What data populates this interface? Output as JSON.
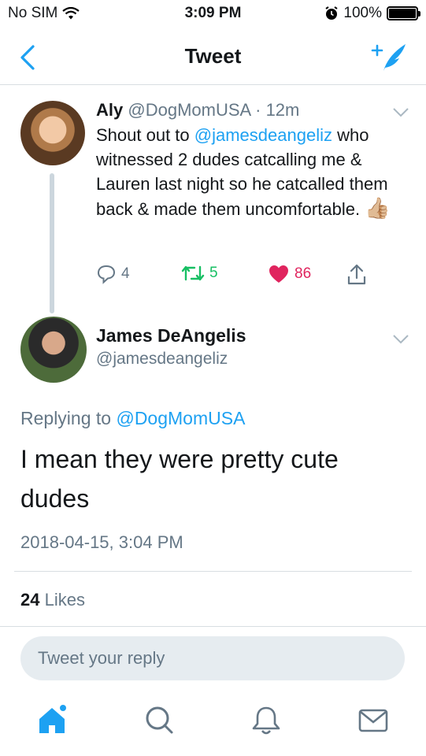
{
  "status_bar": {
    "carrier": "No SIM",
    "time": "3:09 PM",
    "battery": "100%",
    "battery_level": 1.0
  },
  "nav": {
    "title": "Tweet",
    "back_icon": "chevron-left-icon",
    "compose_icon": "compose-tweet-icon"
  },
  "original_tweet": {
    "name": "Aly",
    "handle": "@DogMomUSA",
    "separator": "·",
    "time": "12m",
    "text_before": "Shout out to ",
    "mention": "@jamesdeangeliz",
    "text_after": " who witnessed 2 dudes catcalling me & Lauren last night so he catcalled them back & made them uncomfortable. ",
    "emoji": "👍🏼",
    "replies": "4",
    "retweets": "5",
    "likes": "86"
  },
  "reply_tweet": {
    "name": "James DeAngelis",
    "handle": "@jamesdeangeliz",
    "replying_prefix": "Replying to ",
    "replying_to": "@DogMomUSA",
    "text": "I mean they were pretty cute dudes",
    "timestamp": "2018-04-15, 3:04 PM",
    "likes_count": "24",
    "likes_label": "Likes"
  },
  "composer": {
    "placeholder": "Tweet your reply"
  },
  "colors": {
    "accent": "#1da1f2",
    "retweet": "#17bf63",
    "like": "#e0245e",
    "muted": "#657786"
  }
}
